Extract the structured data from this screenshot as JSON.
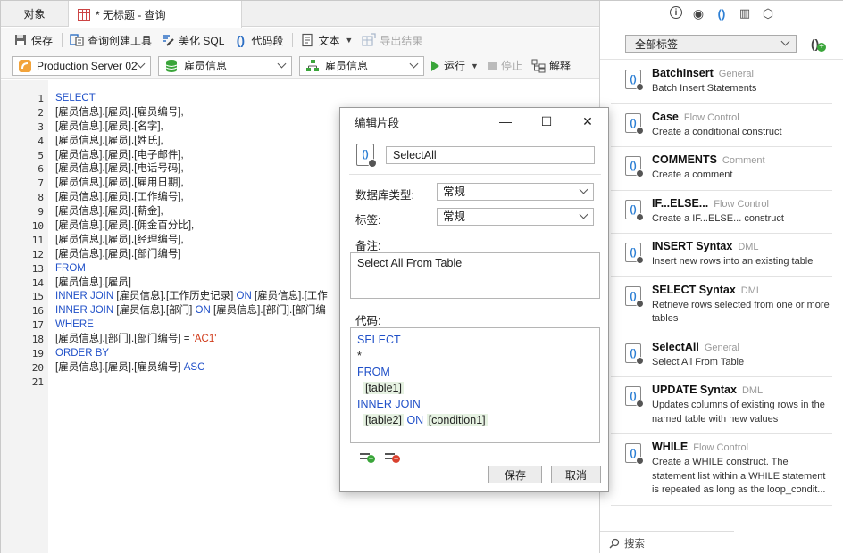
{
  "tabs": [
    {
      "label": "对象"
    },
    {
      "label": "* 无标题 - 查询"
    }
  ],
  "toolbar1": {
    "save": "保存",
    "query_builder": "查询创建工具",
    "beautify": "美化 SQL",
    "snippet": "代码段",
    "text": "文本",
    "export": "导出结果"
  },
  "toolbar2": {
    "connection": "Production Server 02",
    "database": "雇员信息",
    "schema": "雇员信息",
    "run": "运行",
    "stop": "停止",
    "explain": "解释"
  },
  "editor": {
    "line_numbers": [
      "1",
      "2",
      "3",
      "4",
      "5",
      "6",
      "7",
      "8",
      "9",
      "10",
      "11",
      "12",
      "13",
      "14",
      "15",
      "16",
      "17",
      "18",
      "19",
      "20",
      "21"
    ],
    "lines": [
      [
        {
          "t": "SELECT",
          "k": 1
        }
      ],
      [
        {
          "t": "[雇员信息].[雇员].[雇员编号],"
        }
      ],
      [
        {
          "t": "[雇员信息].[雇员].[名字],"
        }
      ],
      [
        {
          "t": "[雇员信息].[雇员].[姓氏],"
        }
      ],
      [
        {
          "t": "[雇员信息].[雇员].[电子邮件],"
        }
      ],
      [
        {
          "t": "[雇员信息].[雇员].[电话号码],"
        }
      ],
      [
        {
          "t": "[雇员信息].[雇员].[雇用日期],"
        }
      ],
      [
        {
          "t": "[雇员信息].[雇员].[工作编号],"
        }
      ],
      [
        {
          "t": "[雇员信息].[雇员].[薪金],"
        }
      ],
      [
        {
          "t": "[雇员信息].[雇员].[佣金百分比],"
        }
      ],
      [
        {
          "t": "[雇员信息].[雇员].[经理编号],"
        }
      ],
      [
        {
          "t": "[雇员信息].[雇员].[部门编号]"
        }
      ],
      [
        {
          "t": "FROM",
          "k": 1
        }
      ],
      [
        {
          "t": "[雇员信息].[雇员]"
        }
      ],
      [
        {
          "t": "INNER JOIN",
          "k": 1
        },
        {
          "t": " [雇员信息].[工作历史记录] "
        },
        {
          "t": "ON",
          "k": 1
        },
        {
          "t": " [雇员信息].[工作"
        }
      ],
      [
        {
          "t": "INNER JOIN",
          "k": 1
        },
        {
          "t": " [雇员信息].[部门] "
        },
        {
          "t": "ON",
          "k": 1
        },
        {
          "t": " [雇员信息].[部门].[部门编"
        }
      ],
      [
        {
          "t": "WHERE",
          "k": 1
        }
      ],
      [
        {
          "t": "[雇员信息].[部门].[部门编号] = "
        },
        {
          "t": "'AC1'",
          "s": 1
        }
      ],
      [
        {
          "t": "ORDER BY",
          "k": 1
        }
      ],
      [
        {
          "t": "[雇员信息].[雇员].[雇员编号] "
        },
        {
          "t": "ASC",
          "k": 1
        }
      ],
      []
    ]
  },
  "right_panel": {
    "tag_filter": "全部标签",
    "search_placeholder": "搜索",
    "snippets": [
      {
        "title": "BatchInsert",
        "category": "General",
        "desc": "Batch Insert Statements"
      },
      {
        "title": "Case",
        "category": "Flow Control",
        "desc": "Create a conditional construct"
      },
      {
        "title": "COMMENTS",
        "category": "Comment",
        "desc": "Create a comment"
      },
      {
        "title": "IF...ELSE...",
        "category": "Flow Control",
        "desc": "Create a IF...ELSE... construct"
      },
      {
        "title": "INSERT Syntax",
        "category": "DML",
        "desc": "Insert new rows into an existing table"
      },
      {
        "title": "SELECT Syntax",
        "category": "DML",
        "desc": "Retrieve rows selected from one or more tables"
      },
      {
        "title": "SelectAll",
        "category": "General",
        "desc": "Select All From Table"
      },
      {
        "title": "UPDATE Syntax",
        "category": "DML",
        "desc": "Updates columns of existing rows in the named table with new values"
      },
      {
        "title": "WHILE",
        "category": "Flow Control",
        "desc": "Create a WHILE construct. The statement list within a WHILE statement is repeated as long as the loop_condit..."
      }
    ]
  },
  "dialog": {
    "title": "编辑片段",
    "name": "SelectAll",
    "db_type_label": "数据库类型:",
    "db_type_value": "常规",
    "tag_label": "标签:",
    "tag_value": "常规",
    "note_label": "备注:",
    "note_value": "Select All From Table",
    "code_label": "代码:",
    "code": {
      "select": "SELECT",
      "star": "*",
      "from": "FROM",
      "table1": "[table1]",
      "inner_join": "INNER JOIN",
      "table2": "[table2]",
      "on": "ON",
      "condition1": "[condition1]"
    },
    "save": "保存",
    "cancel": "取消"
  }
}
